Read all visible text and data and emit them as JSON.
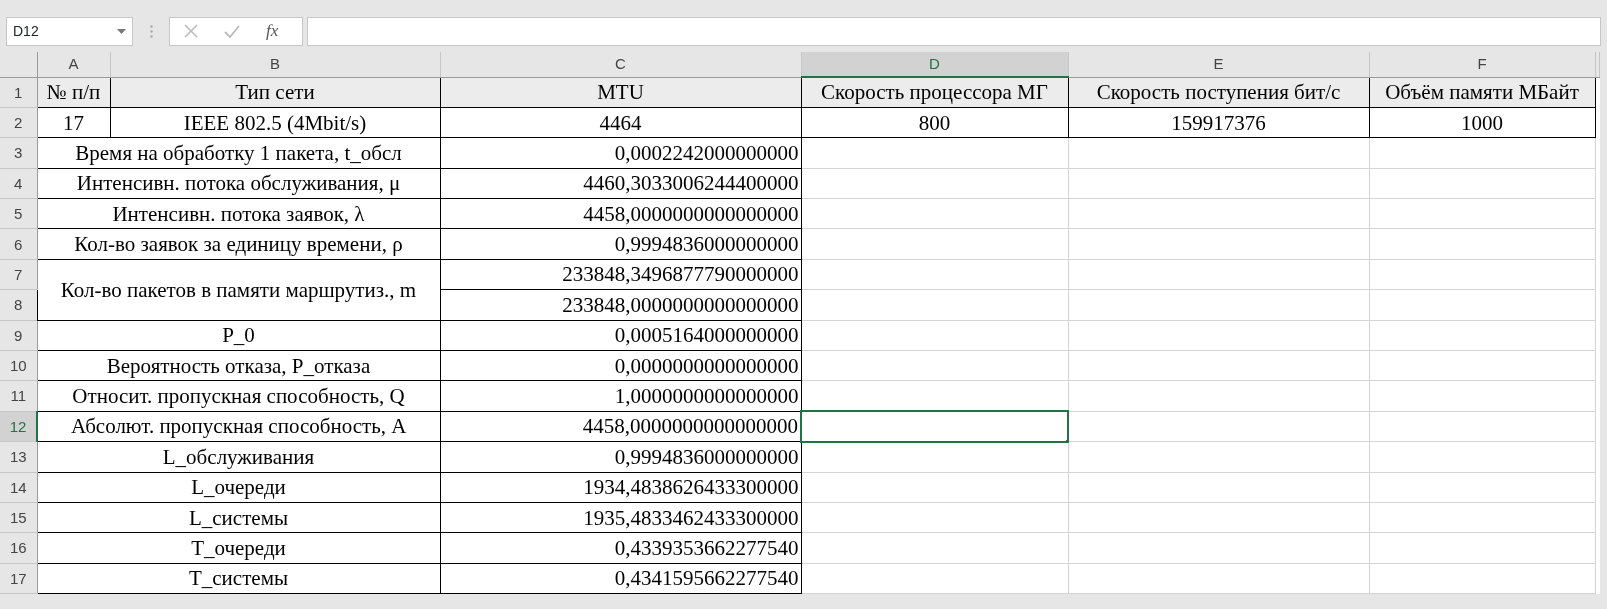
{
  "name_box": {
    "value": "D12"
  },
  "formula_bar": {
    "function_label": "fx"
  },
  "columns": [
    {
      "label": "A",
      "selected": false
    },
    {
      "label": "B",
      "selected": false
    },
    {
      "label": "C",
      "selected": false
    },
    {
      "label": "D",
      "selected": true
    },
    {
      "label": "E",
      "selected": false
    },
    {
      "label": "F",
      "selected": false
    }
  ],
  "row_headers": [
    {
      "label": "1",
      "selected": false
    },
    {
      "label": "2",
      "selected": false
    },
    {
      "label": "3",
      "selected": false
    },
    {
      "label": "4",
      "selected": false
    },
    {
      "label": "5",
      "selected": false
    },
    {
      "label": "6",
      "selected": false
    },
    {
      "label": "7",
      "selected": false
    },
    {
      "label": "8",
      "selected": false
    },
    {
      "label": "9",
      "selected": false
    },
    {
      "label": "10",
      "selected": false
    },
    {
      "label": "11",
      "selected": false
    },
    {
      "label": "12",
      "selected": true
    },
    {
      "label": "13",
      "selected": false
    },
    {
      "label": "14",
      "selected": false
    },
    {
      "label": "15",
      "selected": false
    },
    {
      "label": "16",
      "selected": false
    },
    {
      "label": "17",
      "selected": false
    }
  ],
  "header_row": [
    "№ п/п",
    "Тип сети",
    "MTU",
    "Скорость процессора МГ",
    "Скорость поступения бит/с",
    "Объём памяти МБайт"
  ],
  "data_row": [
    "17",
    "IEEE 802.5 (4Mbit/s)",
    "4464",
    "800",
    "159917376",
    "1000"
  ],
  "metrics": [
    {
      "label": "Время на обработку 1 пакета, t_обсл",
      "values": [
        "0,0002242000000000"
      ]
    },
    {
      "label": "Интенсивн. потока обслуживания, μ",
      "values": [
        "4460,3033006244400000"
      ]
    },
    {
      "label": "Интенсивн. потока заявок,  λ",
      "values": [
        "4458,0000000000000000"
      ]
    },
    {
      "label": "Кол-во заявок за единицу времени, ρ",
      "values": [
        "0,9994836000000000"
      ]
    },
    {
      "label": "Кол-во пакетов в памяти маршрутиз., m",
      "values": [
        "233848,3496877790000000",
        "233848,0000000000000000"
      ]
    },
    {
      "label": "P_0",
      "values": [
        "0,0005164000000000"
      ]
    },
    {
      "label": "Вероятность отказа, P_отказа",
      "values": [
        "0,0000000000000000"
      ]
    },
    {
      "label": "Относит. пропускная способность, Q",
      "values": [
        "1,0000000000000000"
      ]
    },
    {
      "label": "Абсолют. пропускная способность, A",
      "values": [
        "4458,0000000000000000"
      ]
    },
    {
      "label": "L_обслуживания",
      "values": [
        "0,9994836000000000"
      ]
    },
    {
      "label": "L_очереди",
      "values": [
        "1934,4838626433300000"
      ]
    },
    {
      "label": "L_системы",
      "values": [
        "1935,4833462433300000"
      ]
    },
    {
      "label": "T_очереди",
      "values": [
        "0,4339353662277540"
      ]
    },
    {
      "label": "T_системы",
      "values": [
        "0,4341595662277540"
      ]
    }
  ]
}
